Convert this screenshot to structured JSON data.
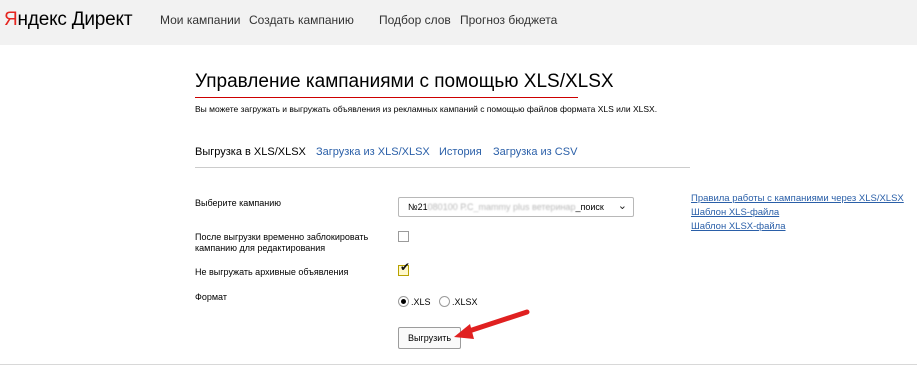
{
  "header": {
    "logo": {
      "brand_first": "Я",
      "brand_rest": "ндекс",
      "product": "Директ"
    },
    "nav": [
      "Мои кампании",
      "Создать кампанию",
      "Подбор слов",
      "Прогноз бюджета"
    ]
  },
  "page": {
    "title": "Управление кампаниями с помощью XLS/XLSX",
    "subtitle": "Вы можете загружать и выгружать объявления из рекламных кампаний с помощью файлов формата XLS или XLSX."
  },
  "tabs": [
    {
      "label": "Выгрузка в XLS/XLSX",
      "active": true
    },
    {
      "label": "Загрузка из XLS/XLSX",
      "active": false
    },
    {
      "label": "История",
      "active": false
    },
    {
      "label": "Загрузка из CSV",
      "active": false
    }
  ],
  "form": {
    "campaign_label": "Выберите кампанию",
    "campaign_select": {
      "prefix": "№21",
      "blurred": "080100 Р.С_mammy plus   ветеринар",
      "suffix": "_поиск"
    },
    "lock_label_line1": "После выгрузки временно заблокировать",
    "lock_label_line2": "кампанию для редактирования",
    "lock_checked": false,
    "archive_label": "Не выгружать архивные объявления",
    "archive_checked": true,
    "format_label": "Формат",
    "formats": [
      {
        "label": ".XLS",
        "selected": true
      },
      {
        "label": ".XLSX",
        "selected": false
      }
    ],
    "submit_label": "Выгрузить"
  },
  "side_links": [
    "Правила работы с кампаниями через XLS/XLSX",
    "Шаблон XLS-файла",
    "Шаблон XLSX-файла"
  ],
  "colors": {
    "header_bg": "#f2f2f2",
    "brand_red": "#e52620",
    "link_blue": "#2a5fa8",
    "title_underline": "#cc0000",
    "annotation_arrow": "#e02020"
  },
  "icons": {
    "select_arrow": "chevron-down-icon",
    "annotation": "red-arrow-icon"
  }
}
